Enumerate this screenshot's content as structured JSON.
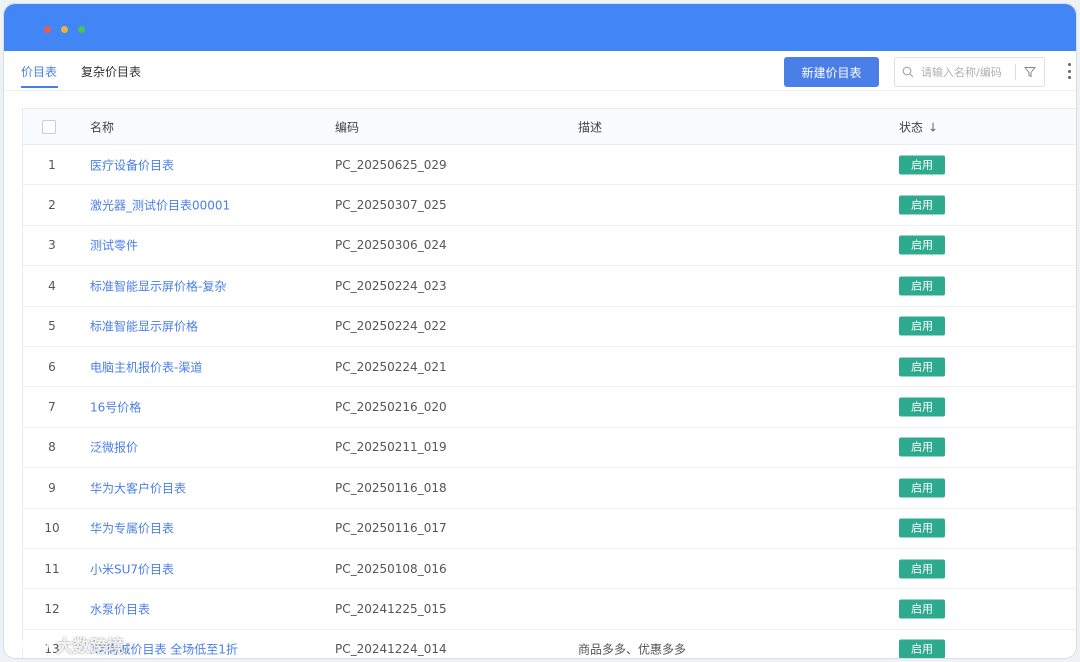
{
  "tabs": [
    {
      "label": "价目表",
      "active": true
    },
    {
      "label": "复杂价目表",
      "active": false
    }
  ],
  "toolbar": {
    "new_button_label": "新建价目表",
    "search_placeholder": "请输入名称/编码"
  },
  "table": {
    "columns": [
      "名称",
      "编码",
      "描述",
      "状态"
    ],
    "rows": [
      {
        "index": "1",
        "name": "医疗设备价目表",
        "code": "PC_20250625_029",
        "desc": "",
        "status": "启用"
      },
      {
        "index": "2",
        "name": "激光器_测试价目表00001",
        "code": "PC_20250307_025",
        "desc": "",
        "status": "启用"
      },
      {
        "index": "3",
        "name": "测试零件",
        "code": "PC_20250306_024",
        "desc": "",
        "status": "启用"
      },
      {
        "index": "4",
        "name": "标准智能显示屏价格-复杂",
        "code": "PC_20250224_023",
        "desc": "",
        "status": "启用"
      },
      {
        "index": "5",
        "name": "标准智能显示屏价格",
        "code": "PC_20250224_022",
        "desc": "",
        "status": "启用"
      },
      {
        "index": "6",
        "name": "电脑主机报价表-渠道",
        "code": "PC_20250224_021",
        "desc": "",
        "status": "启用"
      },
      {
        "index": "7",
        "name": "16号价格",
        "code": "PC_20250216_020",
        "desc": "",
        "status": "启用"
      },
      {
        "index": "8",
        "name": "泛微报价",
        "code": "PC_20250211_019",
        "desc": "",
        "status": "启用"
      },
      {
        "index": "9",
        "name": "华为大客户价目表",
        "code": "PC_20250116_018",
        "desc": "",
        "status": "启用"
      },
      {
        "index": "10",
        "name": "华为专属价目表",
        "code": "PC_20250116_017",
        "desc": "",
        "status": "启用"
      },
      {
        "index": "11",
        "name": "小米SU7价目表",
        "code": "PC_20250108_016",
        "desc": "",
        "status": "启用"
      },
      {
        "index": "12",
        "name": "水泵价目表",
        "code": "PC_20241225_015",
        "desc": "",
        "status": "启用"
      },
      {
        "index": "13",
        "name": "XX商城价目表 全场低至1折",
        "code": "PC_20241224_014",
        "desc": "商品多多、优惠多多",
        "status": "启用"
      }
    ]
  },
  "watermark": {
    "text": "大数跨境"
  },
  "colors": {
    "titlebar": "#4285f4",
    "accent": "#4a7fe8",
    "status_badge": "#2eaa8f"
  },
  "icons": {
    "search": "search-icon",
    "filter": "filter-icon",
    "more": "more-vertical-icon",
    "sort": "arrow-down-icon"
  }
}
